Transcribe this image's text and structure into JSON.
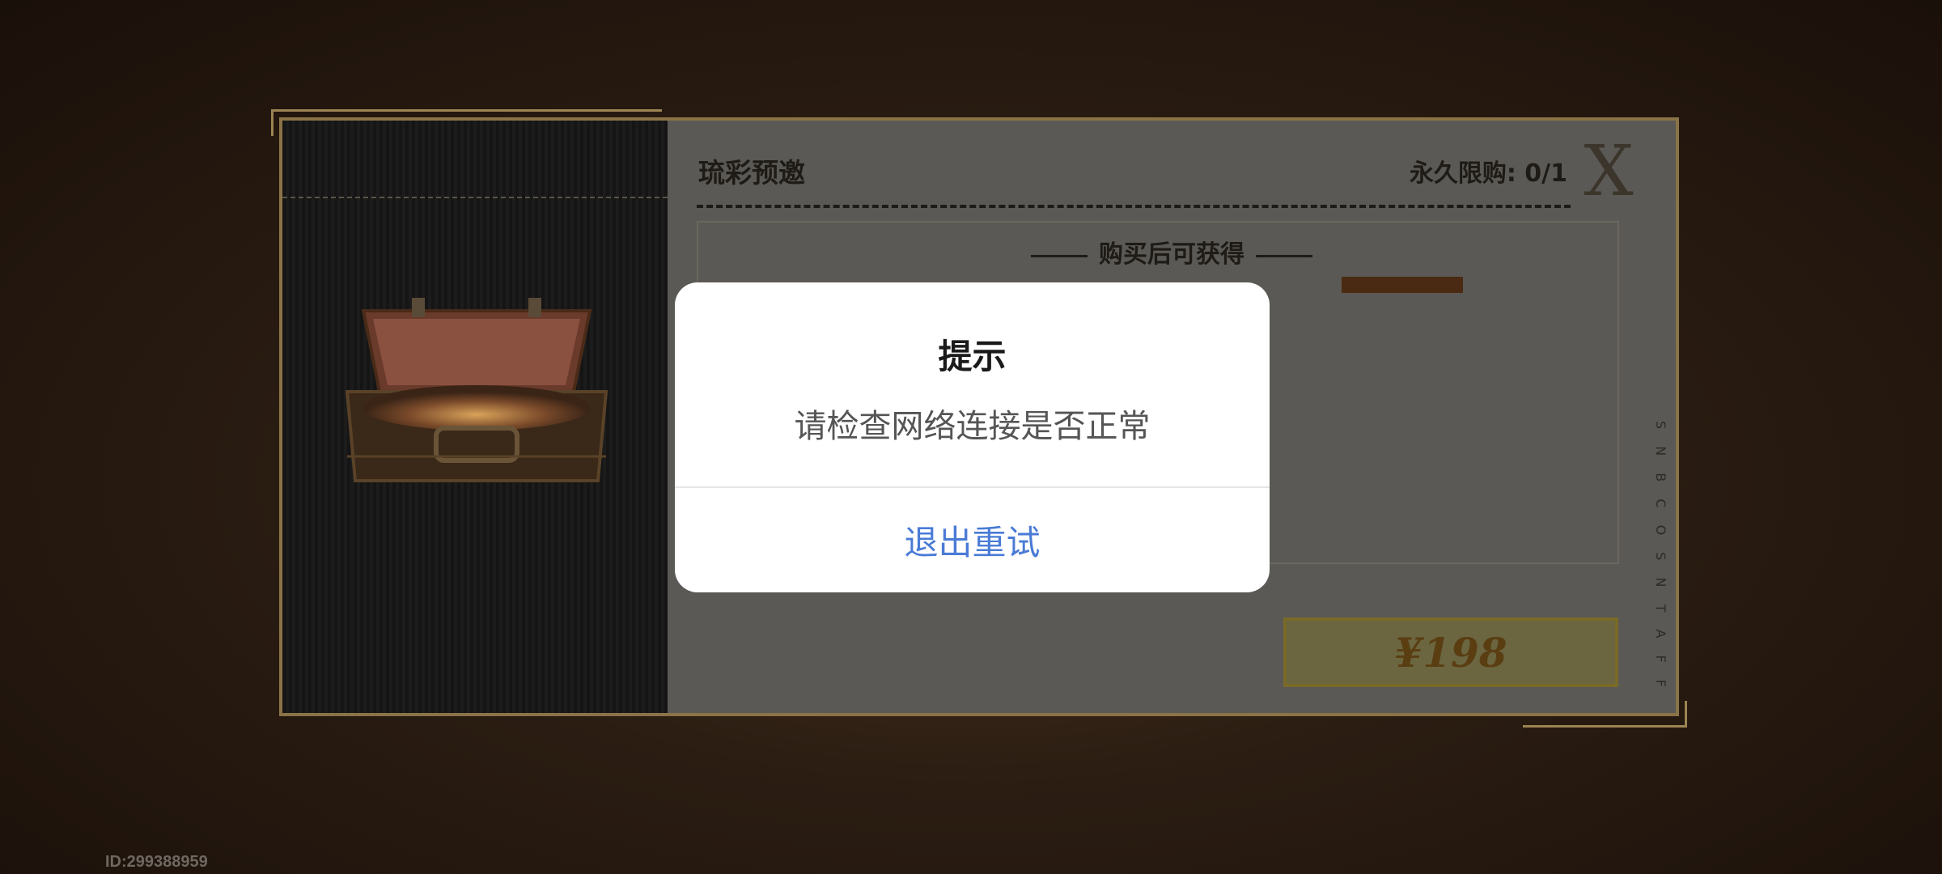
{
  "shop": {
    "package_title": "琉彩预邀",
    "purchase_limit": "永久限购: 0/1",
    "close_glyph": "X",
    "rewards_label": "购买后可获得",
    "price": "¥198",
    "side_text": "S N B C O S N T A F F"
  },
  "footer": {
    "user_id": "ID:299388959"
  },
  "dialog": {
    "title": "提示",
    "message": "请检查网络连接是否正常",
    "button_label": "退出重试"
  },
  "colors": {
    "dialog_button": "#4a7bd6",
    "dialog_bg": "#ffffff",
    "panel_border": "#8a7346"
  }
}
